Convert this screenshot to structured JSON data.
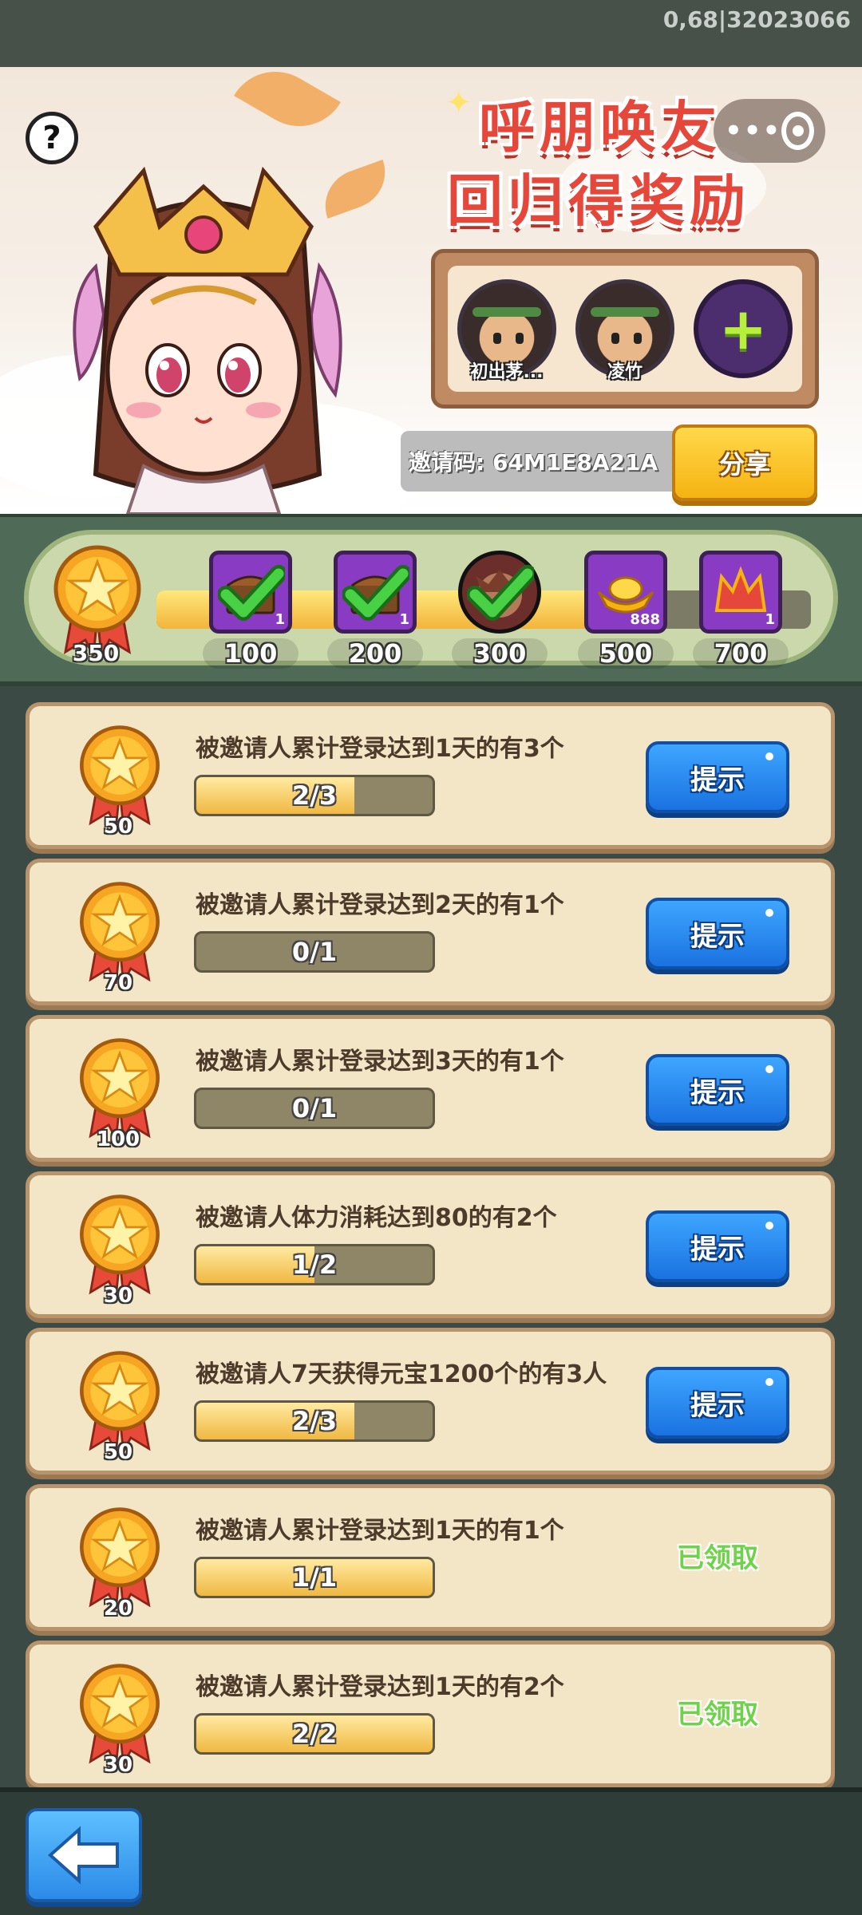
{
  "status_bar": {
    "text": "0,68|32023066"
  },
  "banner": {
    "title_line1": "呼朋唤友",
    "title_line2": "回归得奖励",
    "help_label": "?",
    "more_label": "•••",
    "friends": [
      {
        "name": "初出茅..."
      },
      {
        "name": "凌竹"
      }
    ],
    "add_friend_label": "+",
    "invite_code": "邀请码: 64M1E8A21A",
    "share_label": "分享"
  },
  "milestones": {
    "current_points": "350",
    "progress_fraction": 0.72,
    "items": [
      {
        "points": "100",
        "count": "1",
        "claimed": true,
        "icon": "chest-icon"
      },
      {
        "points": "200",
        "count": "1",
        "claimed": true,
        "icon": "chest-icon"
      },
      {
        "points": "300",
        "count": "",
        "claimed": true,
        "icon": "hero-portrait-icon"
      },
      {
        "points": "500",
        "count": "888",
        "claimed": false,
        "icon": "gold-ingot-icon"
      },
      {
        "points": "700",
        "count": "1",
        "claimed": false,
        "icon": "crown-emblem-icon"
      }
    ]
  },
  "tasks": [
    {
      "points": "50",
      "desc": "被邀请人累计登录达到1天的有3个",
      "progress": "2/3",
      "fill": 0.67,
      "action": "提示",
      "claimed": false
    },
    {
      "points": "70",
      "desc": "被邀请人累计登录达到2天的有1个",
      "progress": "0/1",
      "fill": 0.0,
      "action": "提示",
      "claimed": false
    },
    {
      "points": "100",
      "desc": "被邀请人累计登录达到3天的有1个",
      "progress": "0/1",
      "fill": 0.0,
      "action": "提示",
      "claimed": false
    },
    {
      "points": "30",
      "desc": "被邀请人体力消耗达到80的有2个",
      "progress": "1/2",
      "fill": 0.5,
      "action": "提示",
      "claimed": false
    },
    {
      "points": "50",
      "desc": "被邀请人7天获得元宝1200个的有3人",
      "progress": "2/3",
      "fill": 0.67,
      "action": "提示",
      "claimed": false
    },
    {
      "points": "20",
      "desc": "被邀请人累计登录达到1天的有1个",
      "progress": "1/1",
      "fill": 1.0,
      "action": "已领取",
      "claimed": true
    },
    {
      "points": "30",
      "desc": "被邀请人累计登录达到1天的有2个",
      "progress": "2/2",
      "fill": 1.0,
      "action": "已领取",
      "claimed": true
    }
  ],
  "colors": {
    "accent_gold": "#f5b312",
    "hint_blue": "#1a72e0",
    "claimed_green": "#6fd34a",
    "title_red": "#e5473a"
  }
}
